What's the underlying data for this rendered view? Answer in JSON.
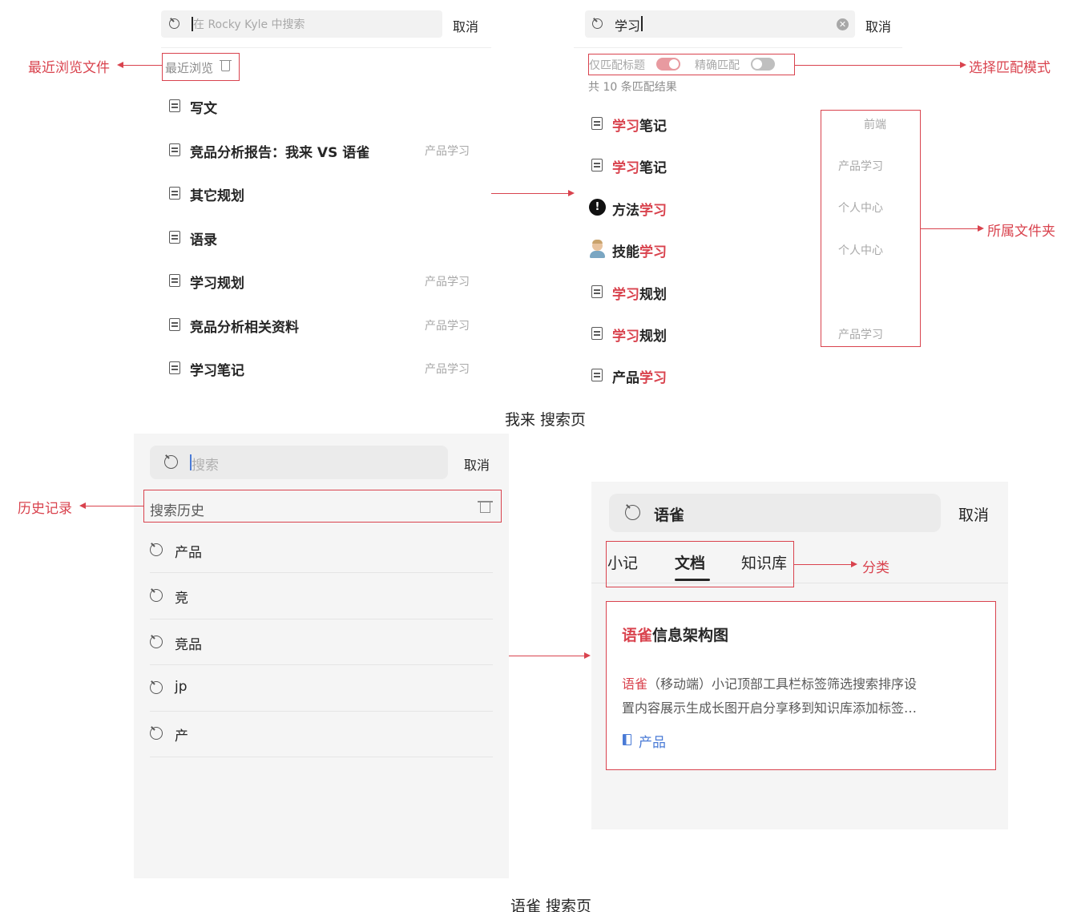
{
  "top_left": {
    "search_placeholder": "在 Rocky Kyle 中搜索",
    "cancel": "取消",
    "recent_label": "最近浏览",
    "items": [
      {
        "title": "写文",
        "folder": ""
      },
      {
        "title": "竞品分析报告：我来 VS 语雀",
        "folder": "产品学习"
      },
      {
        "title": "其它规划",
        "folder": ""
      },
      {
        "title": "语录",
        "folder": ""
      },
      {
        "title": "学习规划",
        "folder": "产品学习"
      },
      {
        "title": "竞品分析相关资料",
        "folder": "产品学习"
      },
      {
        "title": "学习笔记",
        "folder": "产品学习"
      }
    ]
  },
  "top_right": {
    "search_value": "学习",
    "cancel": "取消",
    "toggle_title_only": "仅匹配标题",
    "toggle_exact": "精确匹配",
    "result_count": "共 10 条匹配结果",
    "results": [
      {
        "hl_before": "",
        "hl": "学习",
        "rest": "笔记",
        "folder": "前端",
        "icon": "doc-icon"
      },
      {
        "hl_before": "",
        "hl": "学习",
        "rest": "笔记",
        "folder": "产品学习",
        "icon": "doc-icon"
      },
      {
        "hl_before": "方法",
        "hl": "学习",
        "rest": "",
        "folder": "个人中心",
        "icon": "exclamation-icon"
      },
      {
        "hl_before": "技能",
        "hl": "学习",
        "rest": "",
        "folder": "个人中心",
        "icon": "person-emoji-icon"
      },
      {
        "hl_before": "",
        "hl": "学习",
        "rest": "规划",
        "folder": "",
        "icon": "doc-icon"
      },
      {
        "hl_before": "",
        "hl": "学习",
        "rest": "规划",
        "folder": "产品学习",
        "icon": "doc-icon"
      },
      {
        "hl_before": "产品",
        "hl": "学习",
        "rest": "",
        "folder": "",
        "icon": "doc-icon"
      }
    ]
  },
  "annotations": {
    "recent_files": "最近浏览文件",
    "match_mode": "选择匹配模式",
    "folder": "所属文件夹",
    "history": "历史记录",
    "category": "分类"
  },
  "caption_top": "我来 搜索页",
  "bottom_left": {
    "search_placeholder": "搜索",
    "cancel": "取消",
    "history_label": "搜索历史",
    "history_items": [
      "产品",
      "竞",
      "竞品",
      "jp",
      "产"
    ]
  },
  "bottom_right": {
    "search_value": "语雀",
    "cancel": "取消",
    "tabs": [
      "小记",
      "文档",
      "知识库"
    ],
    "active_tab": "文档",
    "card": {
      "title_hl": "语雀",
      "title_rest": "信息架构图",
      "snippet_hl": "语雀",
      "snippet_line1_rest": "（移动端）小记顶部工具栏标签筛选搜索排序设",
      "snippet_line2": "置内容展示生成长图开启分享移到知识库添加标签…",
      "book": "产品"
    }
  },
  "caption_bottom": "语雀 搜索页",
  "colors": {
    "highlight": "#d9434e",
    "link_blue": "#4a7bd6",
    "panel_gray": "#f5f5f5"
  }
}
